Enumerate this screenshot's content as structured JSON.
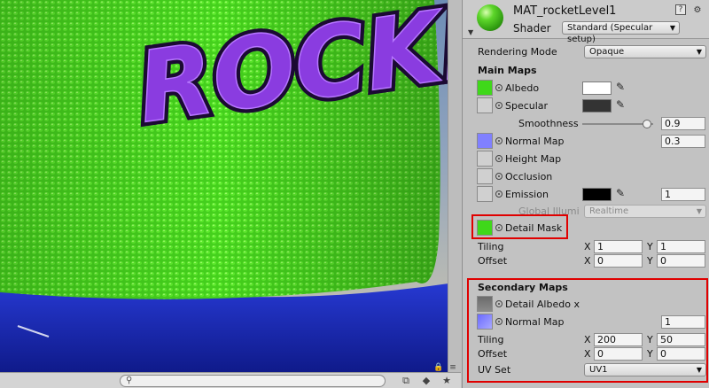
{
  "viewport": {
    "rocket_text": "ROCKET",
    "colors": {
      "green": "#3fd81a",
      "purple": "#7a2fd0",
      "blue": "#1d2fc8"
    }
  },
  "bottombar": {
    "search_placeholder": "",
    "icons": [
      "search-icon",
      "layers-icon",
      "tag-icon",
      "star-icon",
      "lock-icon",
      "menu-icon"
    ]
  },
  "inspector": {
    "material_name": "MAT_rocketLevel1",
    "shader_label": "Shader",
    "shader_value": "Standard (Specular setup)",
    "rendering_mode_label": "Rendering Mode",
    "rendering_mode_value": "Opaque",
    "main_maps_title": "Main Maps",
    "albedo_label": "Albedo",
    "specular_label": "Specular",
    "smoothness_label": "Smoothness",
    "smoothness_value": "0.9",
    "normal_map_label": "Normal Map",
    "normal_map_value": "0.3",
    "height_map_label": "Height Map",
    "occlusion_label": "Occlusion",
    "emission_label": "Emission",
    "emission_value": "1",
    "gi_label": "Global Illumi",
    "gi_value": "Realtime",
    "detail_mask_label": "Detail Mask",
    "tiling_label": "Tiling",
    "offset_label": "Offset",
    "main_tiling": {
      "x": "1",
      "y": "1"
    },
    "main_offset": {
      "x": "0",
      "y": "0"
    },
    "secondary_title": "Secondary Maps",
    "detail_albedo_label": "Detail Albedo x",
    "secondary_normal_label": "Normal Map",
    "secondary_normal_value": "1",
    "secondary_tiling": {
      "x": "200",
      "y": "50"
    },
    "secondary_offset": {
      "x": "0",
      "y": "0"
    },
    "uv_set_label": "UV Set",
    "uv_set_value": "UV1",
    "x_label": "X",
    "y_label": "Y",
    "colors": {
      "highlight": "#e00000",
      "albedo_swatch": "#ffffff",
      "specular_swatch": "#333333",
      "emission_swatch": "#000000",
      "albedo_thumb": "#3fd81a",
      "normal_thumb": "#8080ff"
    }
  }
}
